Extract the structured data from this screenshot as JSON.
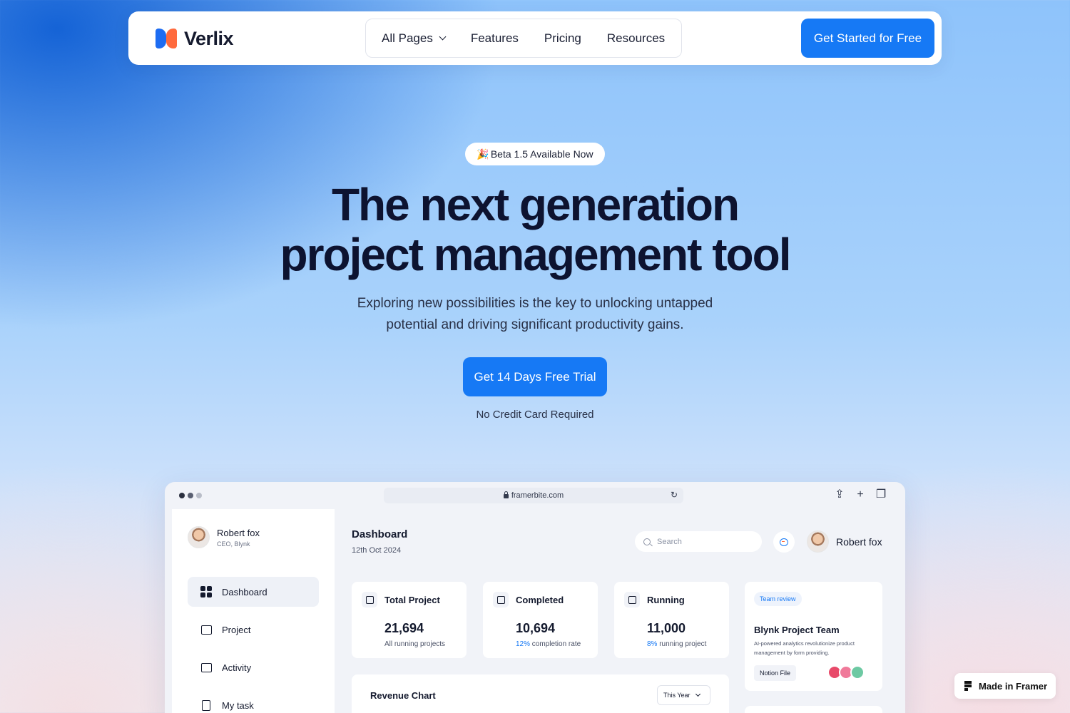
{
  "nav": {
    "logo_text": "Verlix",
    "menu": [
      {
        "label": "All Pages",
        "has_dropdown": true
      },
      {
        "label": "Features"
      },
      {
        "label": "Pricing"
      },
      {
        "label": "Resources"
      }
    ],
    "cta_label": "Get Started for Free"
  },
  "hero": {
    "badge_emoji": "🎉",
    "badge_text": "Beta 1.5 Available Now",
    "title_line1": "The next generation",
    "title_line2": "project management tool",
    "subtitle_line1": "Exploring new possibilities is the key to unlocking untapped",
    "subtitle_line2": "potential and driving significant productivity gains.",
    "cta_label": "Get 14 Days Free Trial",
    "cta_note": "No Credit Card Required"
  },
  "browser": {
    "url": "framerbite.com",
    "sidebar": {
      "user_name": "Robert fox",
      "user_role": "CEO, Blynk",
      "items": [
        {
          "label": "Dashboard",
          "icon": "dashboard-grid-icon",
          "active": true
        },
        {
          "label": "Project",
          "icon": "folder-icon"
        },
        {
          "label": "Activity",
          "icon": "activity-chart-icon"
        },
        {
          "label": "My task",
          "icon": "task-document-icon"
        }
      ]
    },
    "main": {
      "title": "Dashboard",
      "date": "12th Oct 2024",
      "search_placeholder": "Search",
      "user_name": "Robert fox",
      "stats": [
        {
          "label": "Total Project",
          "value": "21,694",
          "note_pct": "",
          "note": "All running projects",
          "icon": "cube-icon"
        },
        {
          "label": "Completed",
          "value": "10,694",
          "note_pct": "12%",
          "note": " completion rate",
          "icon": "trend-up-icon"
        },
        {
          "label": "Running",
          "value": "11,000",
          "note_pct": "8%",
          "note": " running project",
          "icon": "trend-icon"
        }
      ],
      "team_card": {
        "tag": "Team review",
        "name": "Blynk Project Team",
        "description": "AI-powered analytics revolutionize product management by form providing.",
        "button": "Notion File"
      },
      "revenue": {
        "title": "Revenue Chart",
        "period": "This Year"
      }
    }
  },
  "framer_badge": "Made in Framer",
  "colors": {
    "accent": "#1679f5",
    "brand_blue": "#1d6cf2",
    "brand_orange": "#ff6a3d",
    "text_dark": "#0d1330"
  }
}
